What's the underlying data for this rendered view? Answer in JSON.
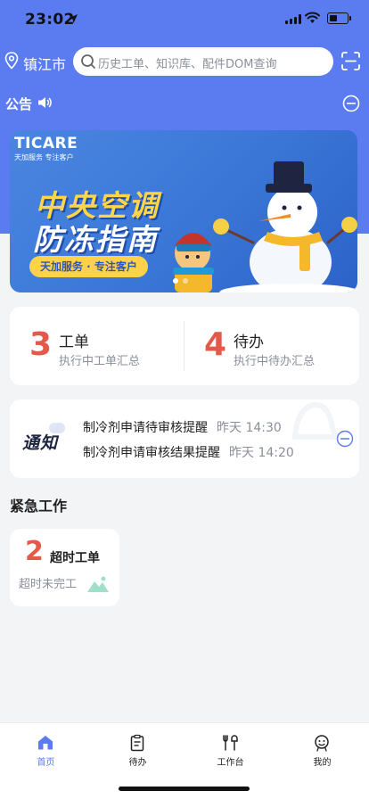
{
  "status_bar": {
    "time": "23:02"
  },
  "header": {
    "city": "镇江市",
    "search_placeholder": "历史工单、知识库、配件DOM查询"
  },
  "notice": {
    "label": "公告"
  },
  "banner": {
    "brand": "TICARE",
    "brand_sub": "天加服务  专注客户",
    "title_line1": "中央空调",
    "title_line2": "防冻指南",
    "pill": "天加服务 · 专注客户"
  },
  "stats": [
    {
      "number": "3",
      "title": "工单",
      "subtitle": "执行中工单汇总"
    },
    {
      "number": "4",
      "title": "待办",
      "subtitle": "执行中待办汇总"
    }
  ],
  "messages": {
    "logo": "通知",
    "items": [
      {
        "text": "制冷剂申请待审核提醒",
        "date": "昨天 14:30"
      },
      {
        "text": "制冷剂申请审核结果提醒",
        "date": "昨天 14:20"
      }
    ]
  },
  "urgent": {
    "section_title": "紧急工作",
    "card": {
      "number": "2",
      "title": "超时工单",
      "subtitle": "超时未完工"
    }
  },
  "tabbar": {
    "items": [
      {
        "label": "首页",
        "icon": "home-icon",
        "active": true
      },
      {
        "label": "待办",
        "icon": "clipboard-icon",
        "active": false
      },
      {
        "label": "工作台",
        "icon": "tools-icon",
        "active": false
      },
      {
        "label": "我的",
        "icon": "profile-icon",
        "active": false
      }
    ]
  },
  "colors": {
    "accent": "#5b7cf0",
    "number_red": "#e3594a",
    "background": "#f3f4f6"
  }
}
